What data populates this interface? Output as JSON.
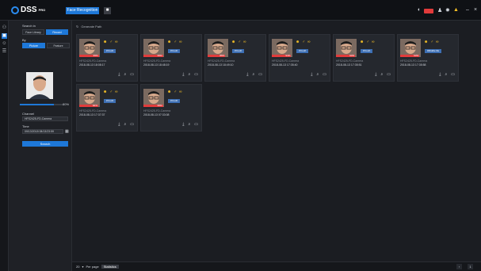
{
  "app": {
    "logo": "DSS",
    "logo_sup": "PRO"
  },
  "tabs": [
    {
      "label": "Face Recognition"
    }
  ],
  "panel": {
    "search_in_label": "Search in",
    "search_in_options": [
      "Face Library",
      "Record"
    ],
    "search_in_selected": "Record",
    "by_label": "By",
    "by_options": [
      "Picture",
      "Feature"
    ],
    "by_selected": "Picture",
    "similarity": "80%",
    "channel_label": "Channel",
    "channel_value": "HFS2425-FD-Camera",
    "time_label": "Time",
    "time_value": "09/13/2018 08/13/23:59",
    "search_button": "Search"
  },
  "main": {
    "breadcrumb": "Generate Path"
  },
  "results": [
    {
      "similarity": "95%",
      "tag": "#Youth",
      "camera": "HFS2425-FD-Camera",
      "time": "2018-08-13 18:08:17"
    },
    {
      "similarity": "95%",
      "tag": "#Youth",
      "camera": "HFS2425-FD-Camera",
      "time": "2018-08-13 18:48:19"
    },
    {
      "similarity": "86%",
      "tag": "#Youth",
      "camera": "HFS2425-FD-Camera",
      "time": "2018-08-13 18:49:10"
    },
    {
      "similarity": "94%",
      "tag": "#Youth",
      "camera": "HFS2425-FD-Camera",
      "time": "2018-08-13 17:35:40"
    },
    {
      "similarity": "93%",
      "tag": "#Youth",
      "camera": "HFS2425-FD-Camera",
      "time": "2018-08-13 17:35:51"
    },
    {
      "similarity": "93%",
      "tag": "#Middle life",
      "camera": "HFS2425-FD-Camera",
      "time": "2018-08-13 17:35:58"
    },
    {
      "similarity": "92%",
      "tag": "#Youth",
      "camera": "HFS2425-FD-Camera",
      "time": "2018-08-13 17:37:37"
    },
    {
      "similarity": "95%",
      "tag": "#Youth",
      "camera": "HFS2425-FD-Camera",
      "time": "2018-08-13 07:33:08"
    }
  ],
  "footer": {
    "per_page_value": "20",
    "per_page_label": "Per page",
    "stat_label": "Statistics",
    "page": "1"
  },
  "colors": {
    "accent": "#1e78d8",
    "alarm": "#e23b3b",
    "attr": "#f5c026"
  }
}
